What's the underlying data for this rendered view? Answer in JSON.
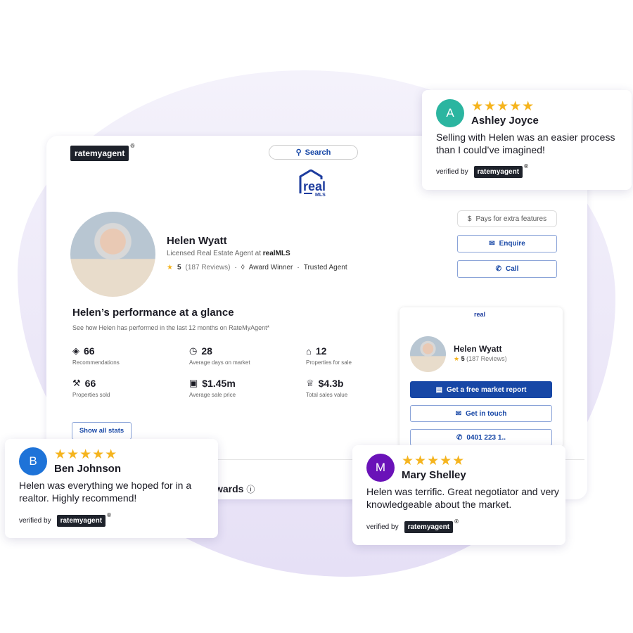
{
  "profile": {
    "brand": "ratemyagent",
    "search": "Search",
    "agency_logo": "real",
    "agency_logo_sub": "MLS",
    "name": "Helen Wyatt",
    "subtitle_prefix": "Licensed Real Estate Agent at",
    "agency": "realMLS",
    "rating": "5",
    "reviews": "(187 Reviews)",
    "badge1": "Award Winner",
    "badge2": "Trusted Agent"
  },
  "actions": {
    "pays": "Pays for extra features",
    "enquire": "Enquire",
    "call": "Call"
  },
  "performance": {
    "title": "Helen’s performance at a glance",
    "subtitle": "See how Helen has performed in the last 12 months on RateMyAgent*",
    "stats": [
      {
        "value": "66",
        "label": "Recommendations",
        "icon": "handshake-icon"
      },
      {
        "value": "28",
        "label": "Average days on market",
        "icon": "clock-icon"
      },
      {
        "value": "12",
        "label": "Properties for sale",
        "icon": "house-icon"
      },
      {
        "value": "66",
        "label": "Properties sold",
        "icon": "gavel-icon"
      },
      {
        "value": "$1.45m",
        "label": "Average sale price",
        "icon": "cash-icon"
      },
      {
        "value": "$4.3b",
        "label": "Total sales value",
        "icon": "trophy-icon"
      }
    ],
    "show_all": "Show all stats",
    "awards": "wards"
  },
  "widget": {
    "name": "Helen Wyatt",
    "rating": "5",
    "reviews": "(187 Reviews)",
    "report": "Get a free market report",
    "touch": "Get in touch",
    "phone": "0401 223 1.."
  },
  "reviews": [
    {
      "initial": "A",
      "name": "Ashley Joyce",
      "text": "Selling with Helen was an easier process than I could’ve imagined!",
      "color": "#2bb5a0"
    },
    {
      "initial": "B",
      "name": "Ben Johnson",
      "text": "Helen was everything we hoped for in a realtor. Highly recommend!",
      "color": "#1e73d8"
    },
    {
      "initial": "M",
      "name": "Mary Shelley",
      "text": "Helen was terrific. Great negotiator and very knowledgeable about the market.",
      "color": "#6a12b8"
    }
  ],
  "verified_by": "verified by",
  "stars": "★★★★★",
  "colors": {
    "accent": "#1747a6",
    "star": "#f5b41e"
  }
}
